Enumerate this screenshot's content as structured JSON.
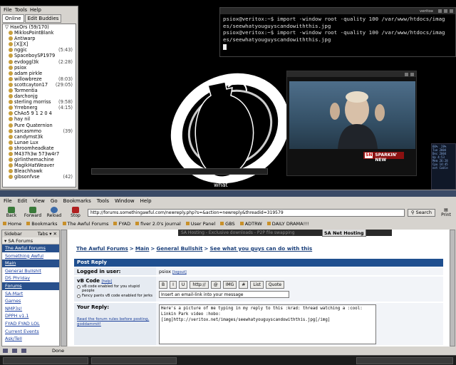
{
  "buddy_list": {
    "menu": [
      "File",
      "Tools",
      "Help"
    ],
    "tabs": [
      "Online",
      "Edit Buddies"
    ],
    "group": "HaxOrs (59/170)",
    "buddies": [
      {
        "name": "MiklosPointBlank",
        "idle": ""
      },
      {
        "name": "Antiwarp",
        "idle": ""
      },
      {
        "name": "[X][X]",
        "idle": ""
      },
      {
        "name": "nggic",
        "idle": "(5:43)"
      },
      {
        "name": "SpaceboySP1979",
        "idle": ""
      },
      {
        "name": "evdoggl3k",
        "idle": "(2:28)"
      },
      {
        "name": "psiox",
        "idle": ""
      },
      {
        "name": "adam pirkle",
        "idle": ""
      },
      {
        "name": "willowbreze",
        "idle": "(8:03)"
      },
      {
        "name": "scottcayton17",
        "idle": "(29:05)"
      },
      {
        "name": "Tormentia",
        "idle": ""
      },
      {
        "name": "darchonjg",
        "idle": ""
      },
      {
        "name": "sterling morriss",
        "idle": "(9:58)"
      },
      {
        "name": "Yrrebnerg",
        "idle": "(4:15)"
      },
      {
        "name": "ChAo5 9 1 2 0 4",
        "idle": ""
      },
      {
        "name": "hay nil",
        "idle": ""
      },
      {
        "name": "Pure Quaternion",
        "idle": ""
      },
      {
        "name": "sarcasmmo",
        "idle": "(39)"
      },
      {
        "name": "candymst3k",
        "idle": ""
      },
      {
        "name": "Lunae Lux",
        "idle": ""
      },
      {
        "name": "shroomheadkate",
        "idle": ""
      },
      {
        "name": "M437h3w 573w4r7",
        "idle": ""
      },
      {
        "name": "girlinthemachine",
        "idle": ""
      },
      {
        "name": "MagikHatWeaver",
        "idle": ""
      },
      {
        "name": "Bleachhawk",
        "idle": ""
      },
      {
        "name": "gibsonfvse",
        "idle": "(42)"
      }
    ]
  },
  "terminal": {
    "title": "veritox",
    "lines": [
      "psiox@veritox:~$ import -window root -quality 100 /var/www/htdocs/imag",
      "es/seewhatyouguyscandowiththis.jpg",
      "psiox@veritox:~$ import -window root -quality 100 /var/www/htdocs/imag",
      "es/seewhatyouguyscandowiththis.jpg"
    ]
  },
  "wallpaper_caption": "what",
  "video": {
    "badge_logo": "SN",
    "badge_text": "SPARKIN' NEW"
  },
  "monitors": {
    "text": "60%  28%\nTue 2004\nDec 2004\nUp 4:53\nMem 26:28\nCpu 14:45\nnet Cable"
  },
  "browser": {
    "menu": [
      "File",
      "Edit",
      "View",
      "Go",
      "Bookmarks",
      "Tools",
      "Window",
      "Help"
    ],
    "nav": {
      "back": "Back",
      "forward": "Forward",
      "reload": "Reload",
      "stop": "Stop",
      "print": "Print",
      "search": "Search"
    },
    "url": "http://forums.somethingawful.com/newreply.php?s=&action=newreply&threadid=319579",
    "bookmarks": [
      "Home",
      "Bookmarks",
      "The Awful Forums",
      "FYAD",
      "fiver 2.0's journal",
      "User Panel",
      "GBS",
      "ADTRW",
      "DAILY DRAMA!!!"
    ],
    "sidebar": {
      "header": "Sidebar",
      "tabs_label": "Tabs",
      "section": "SA Forums",
      "items": [
        {
          "label": "The Awful Forums",
          "hl": true
        },
        {
          "label": "Something Awful",
          "hl": false
        },
        {
          "label": "Main",
          "hl": true
        },
        {
          "label": "General Bullshit",
          "hl": false
        },
        {
          "label": "DS Phriday",
          "hl": false
        },
        {
          "label": "Forums",
          "hl": true
        },
        {
          "label": "SA-Mart",
          "hl": false
        },
        {
          "label": "Games",
          "hl": false
        },
        {
          "label": "NMP3s!",
          "hl": false
        },
        {
          "label": "DPPH v1.1",
          "hl": false
        },
        {
          "label": "FYAD FYAD LOL",
          "hl": false
        },
        {
          "label": "Current Events",
          "hl": false
        },
        {
          "label": "Ask/Tell",
          "hl": false
        }
      ]
    },
    "ad_strip": "SA Hosting - Exclusive downloads - P2P file swapping",
    "ad_box": "SA Net Hosting",
    "breadcrumb": [
      "The Awful Forums",
      "Main",
      "General Bullshit",
      "See what you guys can do with this"
    ],
    "post_reply": {
      "header": "Post Reply",
      "logged_in_label": "Logged in user:",
      "username": "psiox",
      "logout": "[logout]",
      "vbcode_label": "vB Code",
      "vbcode_help": "[help]",
      "radio1": "vB code enabled for you stupid people",
      "radio2": "Fancy pants vB code enabled for jerks",
      "buttons": [
        "B",
        "I",
        "U",
        "http://",
        "@",
        "IMG",
        "#",
        "List",
        "Quote"
      ],
      "email_placeholder": "Insert an email-link into your message",
      "reply_label": "Your Reply:",
      "rules_link": "Read the forum rules before posting, goddammit!",
      "reply_text": "Here's a picture of me typing in my reply to this :krad: thread watching a :cool:\nLinkin Park video :hobo:\n[img]http://veritox.net/images/seewhatyouguyscandowiththis.jpg[/img]"
    },
    "status": "Done"
  }
}
